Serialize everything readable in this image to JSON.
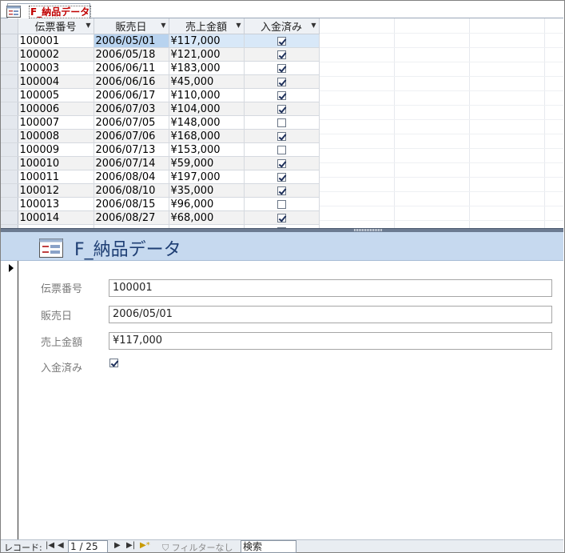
{
  "tab": {
    "label": "F_納品データ",
    "icon": "form-icon"
  },
  "datasheet": {
    "columns": [
      "伝票番号",
      "販売日",
      "売上金額",
      "入金済み"
    ],
    "rows": [
      {
        "id": "100001",
        "date": "2006/05/01",
        "amount": "¥117,000",
        "paid": true
      },
      {
        "id": "100002",
        "date": "2006/05/18",
        "amount": "¥121,000",
        "paid": true
      },
      {
        "id": "100003",
        "date": "2006/06/11",
        "amount": "¥183,000",
        "paid": true
      },
      {
        "id": "100004",
        "date": "2006/06/16",
        "amount": "¥45,000",
        "paid": true
      },
      {
        "id": "100005",
        "date": "2006/06/17",
        "amount": "¥110,000",
        "paid": true
      },
      {
        "id": "100006",
        "date": "2006/07/03",
        "amount": "¥104,000",
        "paid": true
      },
      {
        "id": "100007",
        "date": "2006/07/05",
        "amount": "¥148,000",
        "paid": false
      },
      {
        "id": "100008",
        "date": "2006/07/06",
        "amount": "¥168,000",
        "paid": true
      },
      {
        "id": "100009",
        "date": "2006/07/13",
        "amount": "¥153,000",
        "paid": false
      },
      {
        "id": "100010",
        "date": "2006/07/14",
        "amount": "¥59,000",
        "paid": true
      },
      {
        "id": "100011",
        "date": "2006/08/04",
        "amount": "¥197,000",
        "paid": true
      },
      {
        "id": "100012",
        "date": "2006/08/10",
        "amount": "¥35,000",
        "paid": true
      },
      {
        "id": "100013",
        "date": "2006/08/15",
        "amount": "¥96,000",
        "paid": false
      },
      {
        "id": "100014",
        "date": "2006/08/27",
        "amount": "¥68,000",
        "paid": true
      }
    ]
  },
  "form": {
    "title": "F_納品データ",
    "fields": {
      "id_label": "伝票番号",
      "id_value": "100001",
      "date_label": "販売日",
      "date_value": "2006/05/01",
      "amount_label": "売上金額",
      "amount_value": "¥117,000",
      "paid_label": "入金済み",
      "paid_value": true
    }
  },
  "navbar": {
    "label": "レコード:",
    "position": "1 / 25",
    "filter": "フィルターなし",
    "search": "検索"
  },
  "colors": {
    "header_bg": "#c6d9ef",
    "title": "#1f3f74",
    "tab_label": "#c00000",
    "selection": "#b8d3ef"
  }
}
